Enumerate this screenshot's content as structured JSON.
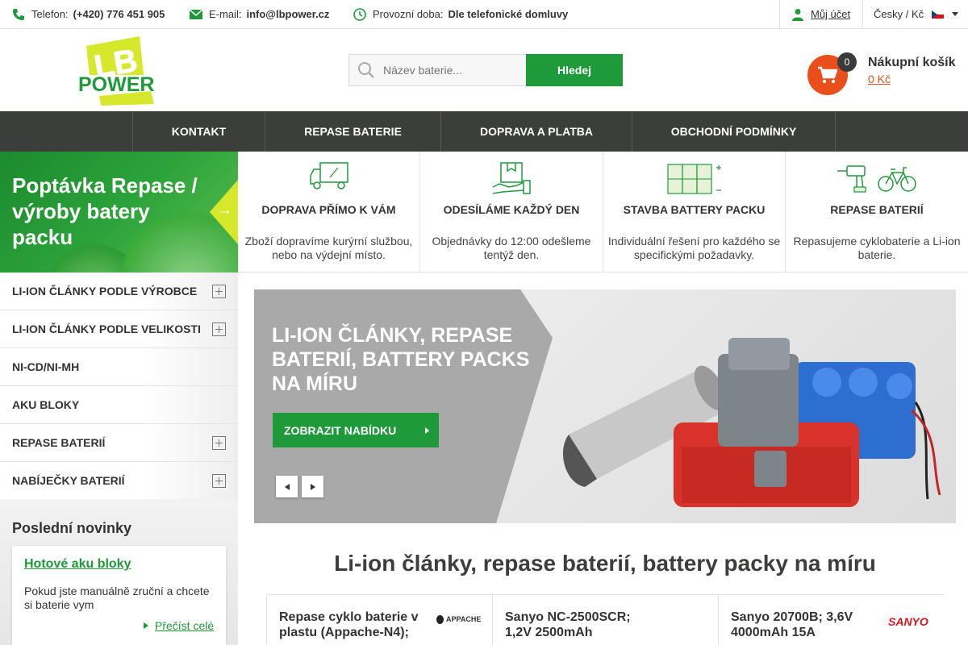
{
  "topbar": {
    "phone_label": "Telefon:",
    "phone": "(+420) 776 451 905",
    "email_label": "E-mail:",
    "email": "info@lbpower.cz",
    "hours_label": "Provozní doba:",
    "hours": "Dle telefonické domluvy",
    "account": "Můj účet",
    "language": "Česky / Kč"
  },
  "logo": {
    "line1": "LB",
    "line2": "POWER"
  },
  "search": {
    "placeholder": "Název baterie...",
    "button": "Hledej"
  },
  "cart": {
    "count": "0",
    "title": "Nákupní košík",
    "sum": "0 Kč"
  },
  "nav": [
    "KONTAKT",
    "REPASE BATERIE",
    "DOPRAVA A PLATBA",
    "OBCHODNÍ PODMÍNKY"
  ],
  "promo": {
    "text": "Poptávka Repase / výroby batery packu"
  },
  "categories": [
    {
      "label": "LI-ION ČLÁNKY PODLE VÝROBCE",
      "expandable": true
    },
    {
      "label": "LI-ION ČLÁNKY PODLE VELIKOSTI",
      "expandable": true
    },
    {
      "label": "NI-CD/NI-MH",
      "expandable": false
    },
    {
      "label": "AKU BLOKY",
      "expandable": false
    },
    {
      "label": "REPASE BATERIÍ",
      "expandable": true
    },
    {
      "label": "NABÍJEČKY BATERIÍ",
      "expandable": true
    }
  ],
  "news": {
    "title": "Poslední novinky",
    "item_title": "Hotové aku bloky",
    "item_text": "Pokud jste manuálně zruční a chcete si baterie vym",
    "more": "Přečíst celé"
  },
  "features": [
    {
      "title": "DOPRAVA PŘÍMO K VÁM",
      "desc": "Zboží dopravíme kurýrní službou, nebo na výdejní místo.",
      "icon": "truck-icon"
    },
    {
      "title": "ODESÍLÁME KAŽDÝ DEN",
      "desc": "Objednávky do 12:00 odešleme tentýž den.",
      "icon": "package-hand-icon"
    },
    {
      "title": "STAVBA BATTERY PACKU",
      "desc": "Individuální řešení pro každého se specifickými požadavky.",
      "icon": "battery-pack-icon"
    },
    {
      "title": "REPASE BATERIÍ",
      "desc": "Repasujeme cyklobaterie a Li-ion baterie.",
      "icon": "drill-bike-icon"
    }
  ],
  "banner": {
    "text": "LI-ION ČLÁNKY, REPASE BATERIÍ, BATTERY PACKS NA MÍRU",
    "button": "ZOBRAZIT NABÍDKU"
  },
  "headline": "Li-ion články, repase baterií, battery packy na míru",
  "products": [
    {
      "name": "Repase cyklo baterie v plastu (Appache-N4);",
      "brand": "APPACHE"
    },
    {
      "name": "Sanyo NC-2500SCR; 1,2V 2500mAh",
      "brand": ""
    },
    {
      "name": "Sanyo 20700B; 3,6V 4000mAh 15A",
      "brand": "SANYO"
    }
  ],
  "colors": {
    "green": "#1e9a3a",
    "orange": "#e94e1b",
    "nav": "#3c3e3c",
    "lime": "#d6e82b"
  }
}
